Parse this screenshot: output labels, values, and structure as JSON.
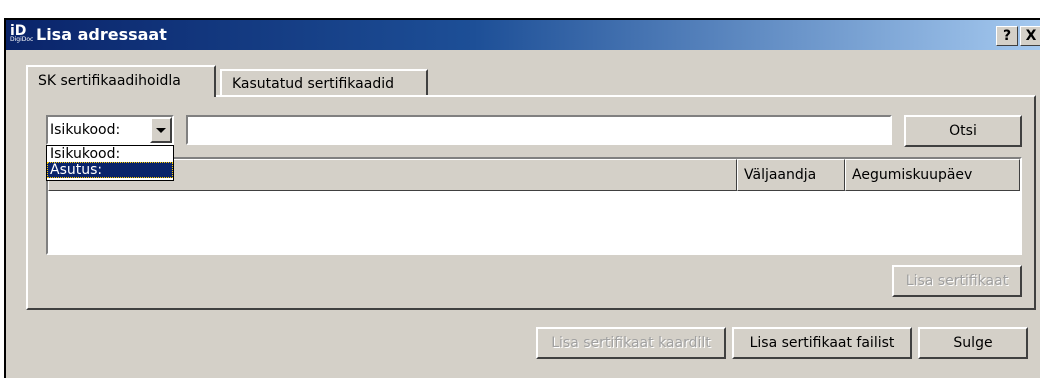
{
  "window": {
    "title": "Lisa adressaat",
    "app_icon_text": "iD",
    "app_icon_subtext": "DigiDoc",
    "help_label": "?",
    "close_label": "X"
  },
  "tabs": [
    {
      "label": "SK sertifikaadihoidla",
      "active": true
    },
    {
      "label": "Kasutatud sertifikaadid",
      "active": false
    }
  ],
  "search": {
    "selected_type": "Isikukood:",
    "dropdown_options": [
      "Isikukood:",
      "Asutus:"
    ],
    "highlighted_option": "Asutus:",
    "query_value": "",
    "search_button": "Otsi"
  },
  "table": {
    "columns": [
      "",
      "Väljaandja",
      "Aegumiskuupäev"
    ],
    "rows": []
  },
  "panel_buttons": {
    "add_certificate": "Lisa sertifikaat"
  },
  "footer_buttons": {
    "add_from_card": "Lisa sertifikaat kaardilt",
    "add_from_file": "Lisa sertifikaat failist",
    "close": "Sulge"
  },
  "colors": {
    "title_gradient_start": "#0a246a",
    "title_gradient_end": "#a6caf0",
    "face": "#d4d0c8",
    "selection": "#0a246a"
  }
}
